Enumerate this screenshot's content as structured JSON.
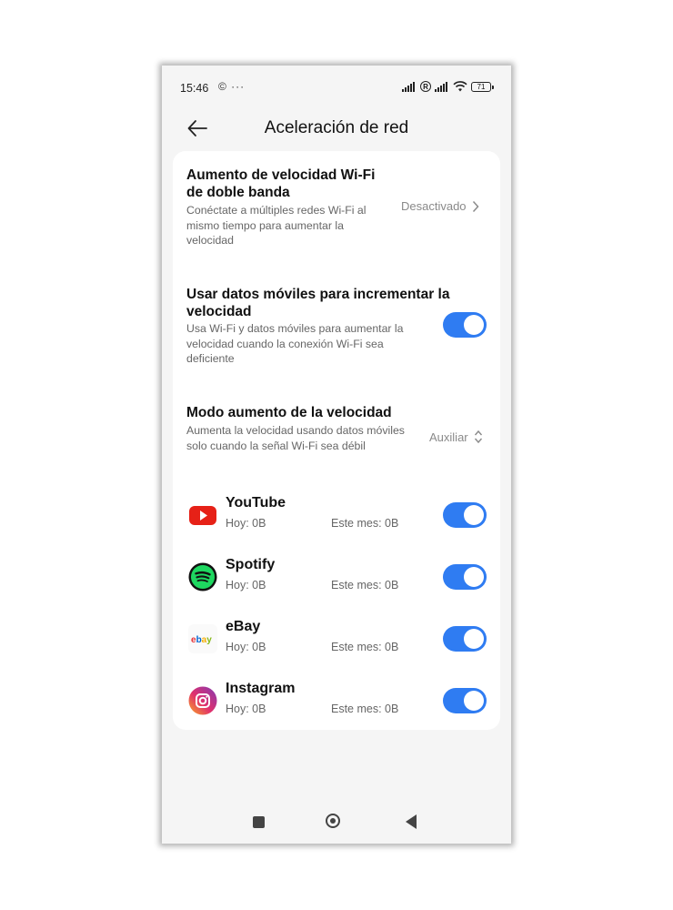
{
  "status_bar": {
    "time": "15:46",
    "left_icons": "© ···",
    "reg_label": "R",
    "battery": "71"
  },
  "header": {
    "title": "Aceleración de red",
    "back_icon": "arrow-left-icon"
  },
  "settings": {
    "dual_band": {
      "title": "Aumento de velocidad Wi-Fi de doble banda",
      "description": "Conéctate a múltiples redes Wi-Fi al mismo tiempo para aumentar la velocidad",
      "value": "Desactivado"
    },
    "mobile_data": {
      "title": "Usar datos móviles para incrementar la velocidad",
      "description": "Usa Wi-Fi y datos móviles para aumentar la velocidad cuando la conexión Wi-Fi sea deficiente",
      "enabled": true
    },
    "speed_mode": {
      "title": "Modo aumento de la velocidad",
      "description": "Aumenta la velocidad usando datos móviles solo cuando la señal Wi-Fi sea débil",
      "value": "Auxiliar"
    }
  },
  "apps": [
    {
      "name": "YouTube",
      "today": "Hoy: 0B",
      "month": "Este mes: 0B",
      "enabled": true,
      "icon": "youtube-icon",
      "color": "#e62117"
    },
    {
      "name": "Spotify",
      "today": "Hoy: 0B",
      "month": "Este mes: 0B",
      "enabled": true,
      "icon": "spotify-icon",
      "color": "#1ed760"
    },
    {
      "name": "eBay",
      "today": "Hoy: 0B",
      "month": "Este mes: 0B",
      "enabled": true,
      "icon": "ebay-icon",
      "logo_text": "ebay"
    },
    {
      "name": "Instagram",
      "today": "Hoy: 0B",
      "month": "Este mes: 0B",
      "enabled": true,
      "icon": "instagram-icon"
    }
  ],
  "colors": {
    "accent": "#2f7cf2",
    "background": "#f5f5f5",
    "card": "#ffffff"
  },
  "nav_bar": {
    "icons": [
      "recents-square-icon",
      "home-circle-icon",
      "back-triangle-icon"
    ]
  }
}
